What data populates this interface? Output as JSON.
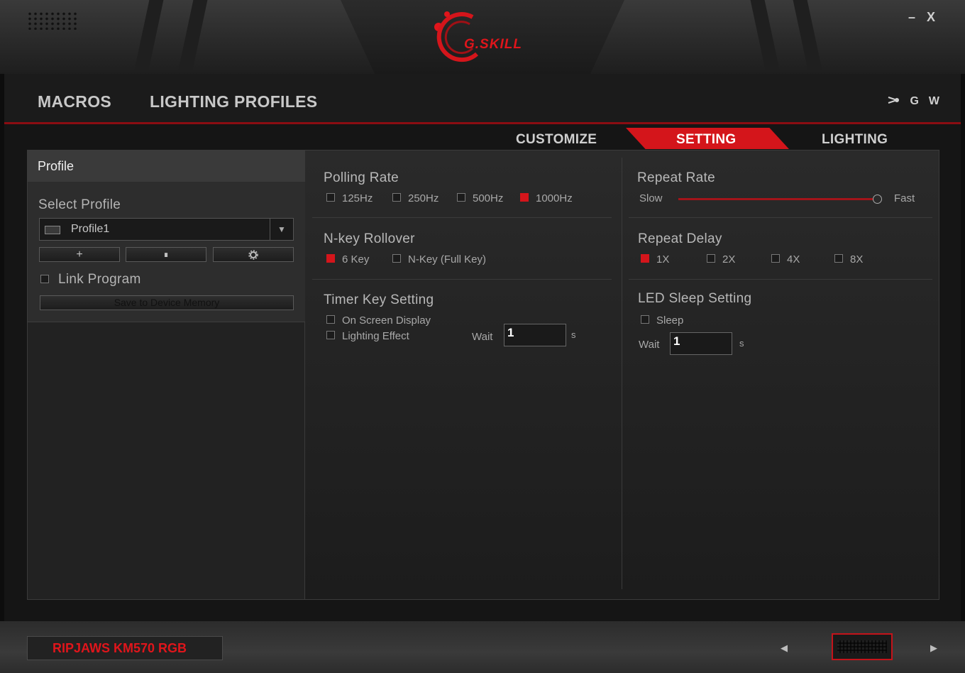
{
  "app": {
    "logo_text": "G.SKILL",
    "minimize_label": "–",
    "close_label": "X"
  },
  "nav": {
    "items": [
      "MACROS",
      "LIGHTING PROFILES"
    ],
    "icons": [
      "share-icon",
      "G",
      "W"
    ]
  },
  "tabs": {
    "items": [
      "CUSTOMIZE",
      "SETTING",
      "LIGHTING"
    ],
    "active": "SETTING"
  },
  "profile": {
    "header": "Profile",
    "select_label": "Select Profile",
    "selected": "Profile1",
    "add_label": "+",
    "delete_label": "∎",
    "settings_icon": "gear-icon",
    "link_program_label": "Link Program",
    "save_label": "Save to Device Memory"
  },
  "polling_rate": {
    "title": "Polling Rate",
    "options": [
      "125Hz",
      "250Hz",
      "500Hz",
      "1000Hz"
    ],
    "selected": "1000Hz"
  },
  "nkey": {
    "title": "N-key Rollover",
    "options": [
      "6 Key",
      "N-Key (Full Key)"
    ],
    "selected": "6 Key"
  },
  "timer": {
    "title": "Timer Key Setting",
    "osd_label": "On Screen Display",
    "lighting_label": "Lighting Effect",
    "wait_label": "Wait",
    "wait_value": "1",
    "unit": "s"
  },
  "repeat_rate": {
    "title": "Repeat Rate",
    "min_label": "Slow",
    "max_label": "Fast",
    "value_fraction": 0.99
  },
  "repeat_delay": {
    "title": "Repeat Delay",
    "options": [
      "1X",
      "2X",
      "4X",
      "8X"
    ],
    "selected": "1X"
  },
  "led_sleep": {
    "title": "LED Sleep Setting",
    "sleep_label": "Sleep",
    "wait_label": "Wait",
    "wait_value": "1",
    "unit": "s"
  },
  "device": {
    "name": "RIPJAWS KM570 RGB",
    "prev": "◀",
    "next": "▶"
  },
  "colors": {
    "accent": "#d4151b",
    "background": "#151515",
    "panel": "#222222"
  }
}
